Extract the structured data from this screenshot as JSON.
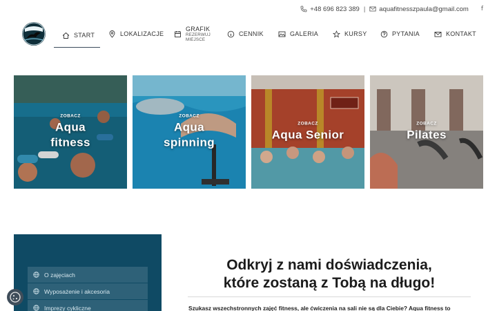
{
  "topbar": {
    "phone": "+48 696 823 389",
    "separator": "|",
    "email": "aquafitnesszpaula@gmail.com",
    "social_icon": "facebook-icon",
    "social_glyph": "f"
  },
  "logo": {
    "icon": "swimmer-logo"
  },
  "nav": {
    "items": [
      {
        "label": "START",
        "icon": "home-icon"
      },
      {
        "label": "LOKALIZACJE",
        "icon": "map-pin-icon"
      },
      {
        "label": "GRAFIK",
        "sub1": "REZERWUJ",
        "sub2": "MIEJSCE",
        "icon": "calendar-icon"
      },
      {
        "label": "CENNIK",
        "icon": "info-icon"
      },
      {
        "label": "GALERIA",
        "icon": "image-icon"
      },
      {
        "label": "KURSY",
        "icon": "star-icon"
      },
      {
        "label": "PYTANIA",
        "icon": "question-icon"
      },
      {
        "label": "KONTAKT",
        "icon": "mail-icon"
      }
    ],
    "active_index": 0
  },
  "tiles": [
    {
      "prefix": "ZOBACZ",
      "title_line1": "Aqua",
      "title_line2": "fitness",
      "bg_color": "#1a6e8a"
    },
    {
      "prefix": "ZOBACZ",
      "title_line1": "Aqua",
      "title_line2": "spinning",
      "bg_color": "#2b9cc8"
    },
    {
      "prefix": "ZOBACZ",
      "title_line1": "Aqua Senior",
      "title_line2": "",
      "bg_color": "#b1452c"
    },
    {
      "prefix": "ZOBACZ",
      "title_line1": "Pilates",
      "title_line2": "",
      "bg_color": "#a59d93"
    }
  ],
  "side_menu": {
    "bg": "#0f4a64",
    "items": [
      {
        "label": "O zajęciach",
        "icon": "globe-icon"
      },
      {
        "label": "Wyposażenie i akcesoria",
        "icon": "globe-icon"
      },
      {
        "label": "Imprezy cykliczne",
        "icon": "globe-icon"
      }
    ]
  },
  "hero": {
    "title_line1": "Odkryj z nami doświadczenia,",
    "title_line2": "które zostaną z Tobą na długo!",
    "text": "Szukasz wszechstronnych zajęć fitness, ale ćwiczenia na sali nie są dla Ciebie? Aqua fitness to"
  },
  "cookie": {
    "icon": "cookie-icon"
  }
}
